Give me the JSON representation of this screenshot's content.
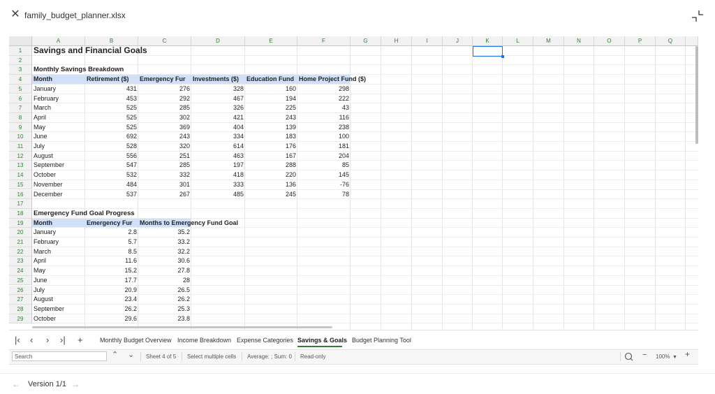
{
  "window": {
    "filename": "family_budget_planner.xlsx"
  },
  "columns": [
    "A",
    "B",
    "C",
    "D",
    "E",
    "F",
    "G",
    "H",
    "I",
    "J",
    "K",
    "L",
    "M",
    "N",
    "O",
    "P",
    "Q"
  ],
  "rows": [
    "1",
    "2",
    "3",
    "4",
    "5",
    "6",
    "7",
    "8",
    "9",
    "10",
    "11",
    "12",
    "13",
    "14",
    "15",
    "16",
    "17",
    "18",
    "19",
    "20",
    "21",
    "22",
    "23",
    "24",
    "25",
    "26",
    "27",
    "28",
    "29"
  ],
  "sheet": {
    "title": "Savings and Financial Goals",
    "breakdown_title": "Monthly Savings Breakdown",
    "breakdown_headers": [
      "Month",
      "Retirement ($)",
      "Emergency Fur",
      "Investments ($)",
      "Education Fund",
      "Home Project Fund ($)"
    ],
    "breakdown_rows": [
      [
        "January",
        "431",
        "276",
        "328",
        "160",
        "298"
      ],
      [
        "February",
        "453",
        "292",
        "467",
        "194",
        "222"
      ],
      [
        "March",
        "525",
        "285",
        "326",
        "225",
        "43"
      ],
      [
        "April",
        "525",
        "302",
        "421",
        "243",
        "116"
      ],
      [
        "May",
        "525",
        "369",
        "404",
        "139",
        "238"
      ],
      [
        "June",
        "692",
        "243",
        "334",
        "183",
        "100"
      ],
      [
        "July",
        "528",
        "320",
        "614",
        "176",
        "181"
      ],
      [
        "August",
        "556",
        "251",
        "463",
        "167",
        "204"
      ],
      [
        "September",
        "547",
        "285",
        "197",
        "288",
        "85"
      ],
      [
        "October",
        "532",
        "332",
        "418",
        "220",
        "145"
      ],
      [
        "November",
        "484",
        "301",
        "333",
        "136",
        "-76"
      ],
      [
        "December",
        "537",
        "267",
        "485",
        "245",
        "78"
      ]
    ],
    "goal_title": "Emergency Fund Goal Progress",
    "goal_headers": [
      "Month",
      "Emergency Fur",
      "Months to Emergency Fund Goal"
    ],
    "goal_rows": [
      [
        "January",
        "2.8",
        "35.2"
      ],
      [
        "February",
        "5.7",
        "33.2"
      ],
      [
        "March",
        "8.5",
        "32.2"
      ],
      [
        "April",
        "11.6",
        "30.6"
      ],
      [
        "May",
        "15.2",
        "27.8"
      ],
      [
        "June",
        "17.7",
        "28"
      ],
      [
        "July",
        "20.9",
        "26.5"
      ],
      [
        "August",
        "23.4",
        "26.2"
      ],
      [
        "September",
        "26.2",
        "25.3"
      ],
      [
        "October",
        "29.6",
        "23.8"
      ]
    ]
  },
  "tabs": [
    "Monthly Budget Overview",
    "Income Breakdown",
    "Expense Categories",
    "Savings & Goals",
    "Budget Planning Tool"
  ],
  "active_tab": "Savings & Goals",
  "status": {
    "search_placeholder": "Search",
    "sheet_info": "Sheet 4 of 5",
    "select_mode": "Select multiple cells",
    "summary": "Average: ; Sum: 0",
    "mode": "Read-only",
    "zoom": "100%"
  },
  "footer": {
    "version": "Version 1/1"
  },
  "colors": {
    "header_band": "#cfe0f8",
    "accent": "#2e7d32",
    "selection": "#1a73e8"
  }
}
